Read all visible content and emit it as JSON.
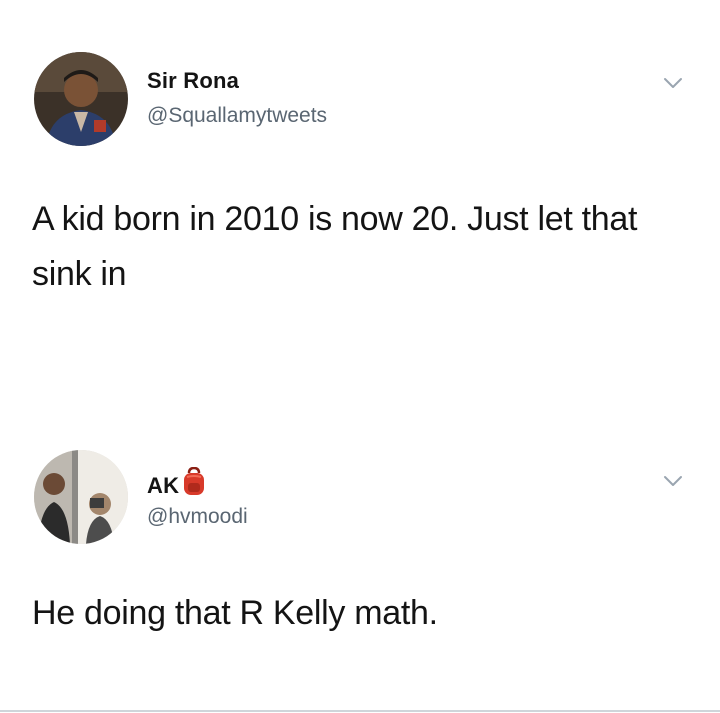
{
  "tweets": [
    {
      "display_name": "Sir Rona",
      "handle": "@Squallamytweets",
      "text": "A kid born in 2010 is now 20. Just let that sink in",
      "avatar_icon": "user-avatar-photo",
      "menu_icon": "chevron-down-icon"
    },
    {
      "display_name": "AK",
      "handle": "@hvmoodi",
      "text": "He doing that R Kelly math.",
      "avatar_icon": "user-avatar-photo",
      "badge_icon": "backpack-emoji-icon",
      "menu_icon": "chevron-down-icon"
    }
  ],
  "colors": {
    "text": "#141414",
    "handle": "#5a6672",
    "chevron": "#9aa5b0",
    "background": "#ffffff"
  }
}
